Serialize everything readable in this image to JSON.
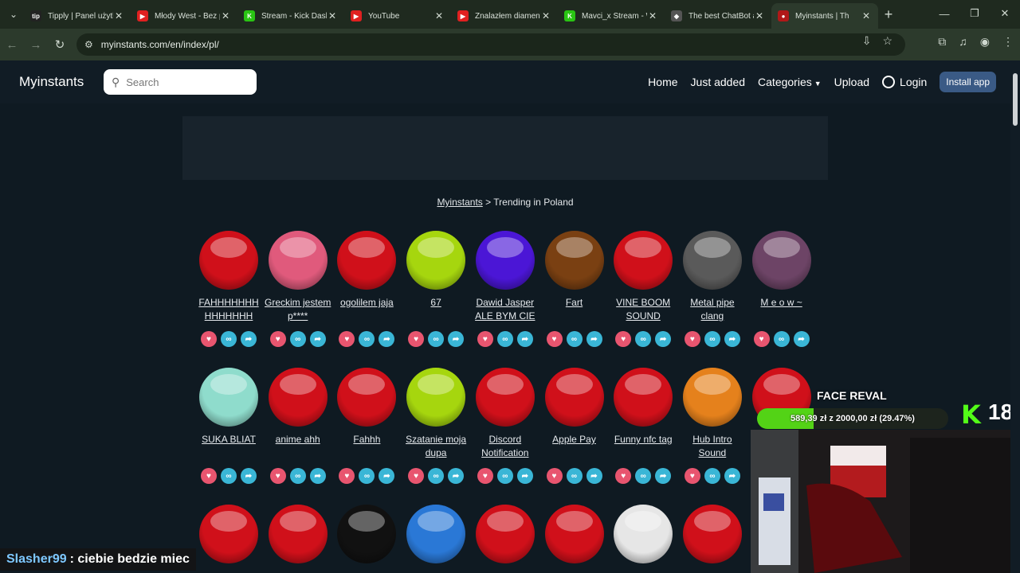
{
  "browser": {
    "tabs": [
      {
        "title": "Tipply | Panel użytko",
        "fav_text": "tip",
        "fav_color": "#222222"
      },
      {
        "title": "Młody West - Bez p",
        "fav_text": "▶",
        "fav_color": "#e02020"
      },
      {
        "title": "Stream - Kick Dashb",
        "fav_text": "K",
        "fav_color": "#29c413"
      },
      {
        "title": "YouTube",
        "fav_text": "▶",
        "fav_color": "#e02020"
      },
      {
        "title": "Znalazłem diamenty",
        "fav_text": "▶",
        "fav_color": "#e02020"
      },
      {
        "title": "Mavci_x Stream - W",
        "fav_text": "K",
        "fav_color": "#29c413"
      },
      {
        "title": "The best ChatBot ar",
        "fav_text": "◆",
        "fav_color": "#555555"
      },
      {
        "title": "Myinstants | Th",
        "fav_text": "●",
        "fav_color": "#b01818"
      }
    ],
    "url": "myinstants.com/en/index/pl/"
  },
  "site": {
    "brand": "Myinstants",
    "search_placeholder": "Search",
    "nav": {
      "home": "Home",
      "just_added": "Just added",
      "categories": "Categories",
      "upload": "Upload",
      "login": "Login",
      "install": "Install app"
    }
  },
  "breadcrumb": {
    "root": "Myinstants",
    "sep": " > ",
    "current": "Trending in Poland"
  },
  "sounds": [
    {
      "label": "FAHHHHHHH HHHHHHH",
      "color": "#d0101a"
    },
    {
      "label": "Greckim jestem p****",
      "color": "#e05a7c"
    },
    {
      "label": "ogolilem jaja",
      "color": "#d0101a"
    },
    {
      "label": "67",
      "color": "#a6d60e"
    },
    {
      "label": "Dawid Jasper ALE BYM CIE",
      "color": "#4b16d6"
    },
    {
      "label": "Fart",
      "color": "#7a4012"
    },
    {
      "label": "VINE BOOM SOUND",
      "color": "#d0101a"
    },
    {
      "label": "Metal pipe clang",
      "color": "#5a5a5a"
    },
    {
      "label": "M e o w ~",
      "color": "#6d4466"
    },
    {
      "label": "SUKA BLIAT",
      "color": "#8fdccc"
    },
    {
      "label": "anime ahh",
      "color": "#d0101a"
    },
    {
      "label": "Fahhh",
      "color": "#d0101a"
    },
    {
      "label": "Szatanie moja dupa",
      "color": "#a6d60e"
    },
    {
      "label": "Discord Notification",
      "color": "#d0101a"
    },
    {
      "label": "Apple Pay",
      "color": "#d0101a"
    },
    {
      "label": "Funny nfc tag",
      "color": "#d0101a"
    },
    {
      "label": "Hub Intro Sound",
      "color": "#e5811c"
    },
    {
      "label": "",
      "color": "#d0101a"
    },
    {
      "label": "",
      "color": "#d0101a"
    },
    {
      "label": "",
      "color": "#d0101a"
    },
    {
      "label": "",
      "color": "#111111"
    },
    {
      "label": "",
      "color": "#2a78d6"
    },
    {
      "label": "",
      "color": "#d0101a"
    },
    {
      "label": "",
      "color": "#d0101a"
    },
    {
      "label": "",
      "color": "#e6e6e6"
    },
    {
      "label": "",
      "color": "#d0101a"
    }
  ],
  "overlay": {
    "goal_title": "FACE REVAL",
    "goal_text": "589,39 zł z 2000,00 zł (29.47%)",
    "goal_fraction": 0.2947,
    "age_badge": "18",
    "kick_logo": "K",
    "chat_user": "Slasher99",
    "chat_msg": ": ciebie bedzie miec"
  }
}
